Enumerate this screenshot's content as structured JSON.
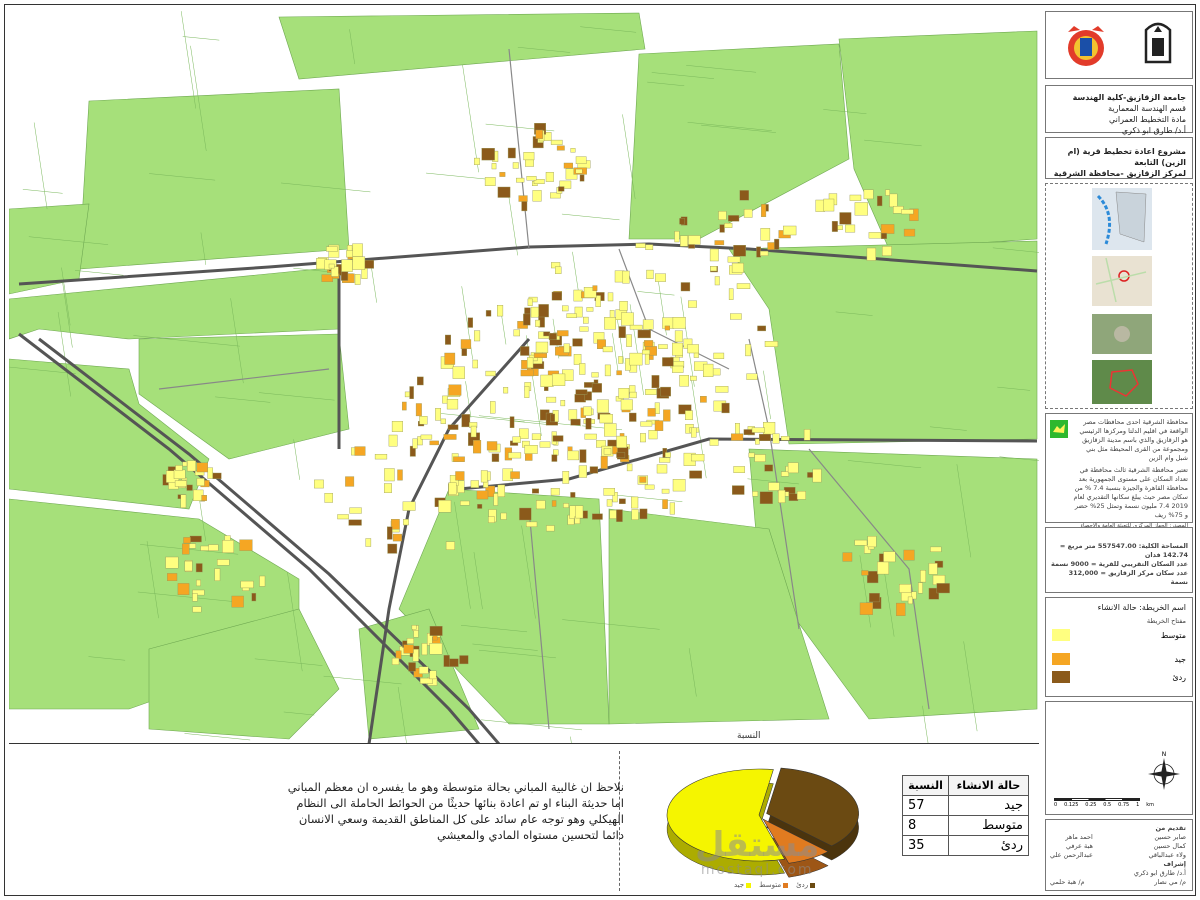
{
  "map": {
    "bottom_label": "النسبة"
  },
  "header": {
    "institution_lines": [
      "جامعة الزقازيق-كلية الهندسة",
      "قسم الهندسة المعمارية",
      "مادة التخطيط العمراني",
      "أ.د/ طارق ابو ذكري"
    ],
    "project_lines": [
      "مشروع اعادة تخطيط قرية (ام الزين) التابعة",
      "لمركز الزقازيق -محافظة الشرقية"
    ]
  },
  "location_text": {
    "para1": "محافظة الشرقية احدى محافظات مصر الواقعة في اقليم الدلتا ومركزها الرئيسي هو الزقازيق والذي باسم مدينة الزقازيق ومجموعة من القرى المحيطة مثل بني شبل وام الزين",
    "para2": "تعتبر محافظة الشرقية ثالث محافظة في تعداد السكان على مستوى الجمهورية بعد محافظة القاهرة والجيزة بنسبة 7.4 % من سكان مصر حيث يبلغ سكانها التقديري لعام 2019 7.4 مليون نسمة وتمثل 25% حضر و 75% ريف",
    "source": "المصدر: الجهاز المركزي للتعبئة العامة والاحصاء"
  },
  "stats": {
    "area": "المساحة الكلية: 557547.00 متر مربع = 142.74 فدان",
    "population": "عدد السكان التقريبي للقرية = 9000 نسمة",
    "district_population": "عدد سكان مركز الزقازيق = 312,000 نسمة"
  },
  "map_key": {
    "map_name": "اسم الخريطة: حالة الانشاء",
    "key_title": "مفتاح الخريطة",
    "items": [
      {
        "label": "متوسط",
        "color": "#ffff80"
      },
      {
        "label": "جيد",
        "color": "#f5a623"
      },
      {
        "label": "ردئ",
        "color": "#8b5a1b"
      }
    ]
  },
  "scale": {
    "ticks": [
      "0",
      "0.125",
      "0.25",
      "0.5",
      "0.75",
      "1"
    ],
    "unit": "km"
  },
  "credits": {
    "submitted_by_label": "تقديم من",
    "names_col1": [
      "صابر حسين",
      "كمال حسين",
      "ولاء عبدالباقي"
    ],
    "names_col2": [
      "احمد ماهر",
      "هبة عرفي",
      "عبدالرحمن علي"
    ],
    "supervised_label": "إشراف",
    "supervisor": "أ.د/ طارق ابو ذكري",
    "assistants": [
      "م/ مي نصار",
      "م/ هبة حلمي"
    ]
  },
  "analysis": {
    "note": "نلاحظ ان غالبية المباني بحالة متوسطة وهو ما يفسره ان معظم المباني اما حديثة البناء او تم اعادة بنائها حديثًا من الحوائط الحاملة الى النظام الهيكلي وهو توجه عام سائد على كل المناطق القديمة وسعي الانسان دائما لتحسين مستواه المادي والمعيشي"
  },
  "table": {
    "col_ratio": "النسبة",
    "col_state": "حالة الانشاء",
    "rows": [
      {
        "state": "جيد",
        "value": "57"
      },
      {
        "state": "متوسط",
        "value": "8"
      },
      {
        "state": "ردئ",
        "value": "35"
      }
    ]
  },
  "chart_data": {
    "type": "pie",
    "title": "",
    "slices": [
      {
        "label": "ردئ",
        "value": 35,
        "color": "#6b4a12"
      },
      {
        "label": "متوسط",
        "value": 8,
        "color": "#e07b20"
      },
      {
        "label": "جيد",
        "value": 57,
        "color": "#f5f500"
      }
    ]
  },
  "watermark": {
    "arabic": "مستقل",
    "latin": "mostaql.com"
  }
}
